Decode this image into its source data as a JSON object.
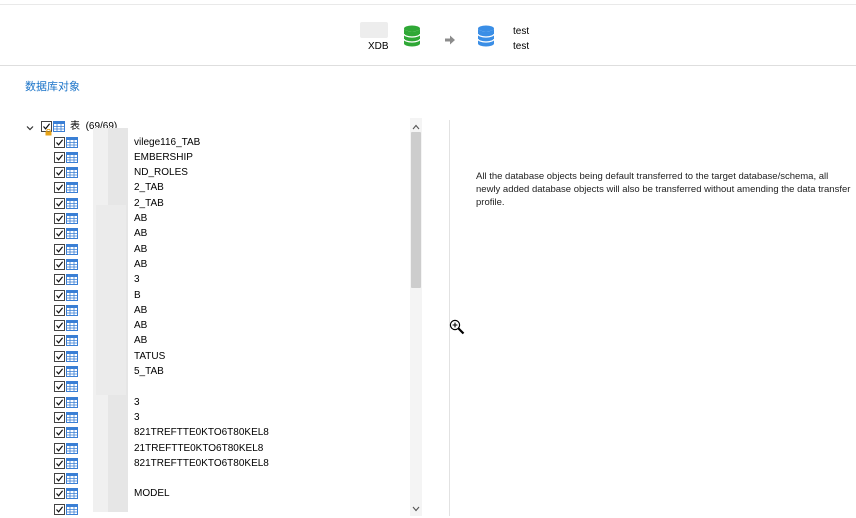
{
  "header": {
    "source_label": "XDB",
    "target_label_1": "test",
    "target_label_2": "test",
    "source_db_color": "#2fa836",
    "target_db_color": "#3a8ee6"
  },
  "section_title": "数据库对象",
  "tree": {
    "root": {
      "label": "表",
      "count": "(69/69)",
      "checked": true
    },
    "items": [
      {
        "label": "vilege116_TAB"
      },
      {
        "label": "EMBERSHIP"
      },
      {
        "label": "ND_ROLES"
      },
      {
        "label": "2_TAB"
      },
      {
        "label": "2_TAB"
      },
      {
        "label": "AB"
      },
      {
        "label": "AB"
      },
      {
        "label": "AB"
      },
      {
        "label": "AB"
      },
      {
        "label": "3"
      },
      {
        "label": "B"
      },
      {
        "label": "AB"
      },
      {
        "label": "AB"
      },
      {
        "label": "AB"
      },
      {
        "label": "TATUS"
      },
      {
        "label": "5_TAB"
      },
      {
        "label": ""
      },
      {
        "label": "3"
      },
      {
        "label": "3"
      },
      {
        "label": "821TREFTTE0KTO6T80KEL8"
      },
      {
        "label": "21TREFTTE0KTO6T80KEL8"
      },
      {
        "label": "821TREFTTE0KTO6T80KEL8"
      },
      {
        "label": ""
      },
      {
        "label": "MODEL"
      },
      {
        "label": ""
      }
    ]
  },
  "description": "All the database objects being default transferred to the target database/schema, all newly added database objects will also be transferred without amending the data transfer profile.",
  "icons": {
    "source_db": "database-icon",
    "target_db": "database-icon",
    "arrow": "arrow-right-icon",
    "tree_toggle": "chevron-down-icon",
    "table": "table-icon",
    "cursor": "zoom-in-icon"
  }
}
